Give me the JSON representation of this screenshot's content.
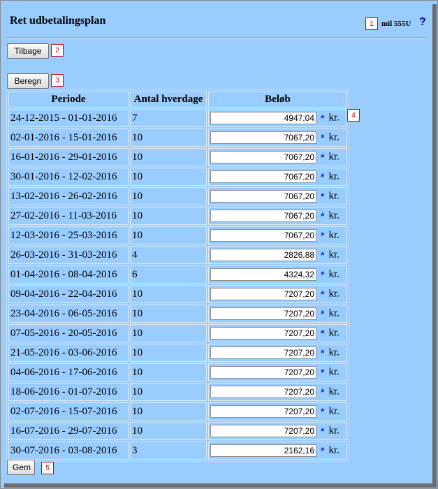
{
  "header": {
    "title": "Ret udbetalingsplan",
    "user": "mil 555U",
    "help": "?"
  },
  "badges": [
    "1",
    "2",
    "3",
    "4",
    "5"
  ],
  "buttons": {
    "back": "Tilbage",
    "calculate": "Beregn",
    "save": "Gem"
  },
  "table": {
    "columns": [
      "Periode",
      "Antal hverdage",
      "Beløb"
    ],
    "required_mark": "*",
    "unit": "kr.",
    "rows": [
      {
        "period": "24-12-2015 - 01-01-2016",
        "days": "7",
        "amount": "4947,04"
      },
      {
        "period": "02-01-2016 - 15-01-2016",
        "days": "10",
        "amount": "7067,20"
      },
      {
        "period": "16-01-2016 - 29-01-2016",
        "days": "10",
        "amount": "7067,20"
      },
      {
        "period": "30-01-2016 - 12-02-2016",
        "days": "10",
        "amount": "7067,20"
      },
      {
        "period": "13-02-2016 - 26-02-2016",
        "days": "10",
        "amount": "7067,20"
      },
      {
        "period": "27-02-2016 - 11-03-2016",
        "days": "10",
        "amount": "7067,20"
      },
      {
        "period": "12-03-2016 - 25-03-2016",
        "days": "10",
        "amount": "7067,20"
      },
      {
        "period": "26-03-2016 - 31-03-2016",
        "days": "4",
        "amount": "2826,88"
      },
      {
        "period": "01-04-2016 - 08-04-2016",
        "days": "6",
        "amount": "4324,32"
      },
      {
        "period": "09-04-2016 - 22-04-2016",
        "days": "10",
        "amount": "7207,20"
      },
      {
        "period": "23-04-2016 - 06-05-2016",
        "days": "10",
        "amount": "7207,20"
      },
      {
        "period": "07-05-2016 - 20-05-2016",
        "days": "10",
        "amount": "7207,20"
      },
      {
        "period": "21-05-2016 - 03-06-2016",
        "days": "10",
        "amount": "7207,20"
      },
      {
        "period": "04-06-2016 - 17-06-2016",
        "days": "10",
        "amount": "7207,20"
      },
      {
        "period": "18-06-2016 - 01-07-2016",
        "days": "10",
        "amount": "7207,20"
      },
      {
        "period": "02-07-2016 - 15-07-2016",
        "days": "10",
        "amount": "7207,20"
      },
      {
        "period": "16-07-2016 - 29-07-2016",
        "days": "10",
        "amount": "7207,20"
      },
      {
        "period": "30-07-2016 - 03-08-2016",
        "days": "3",
        "amount": "2162,16"
      }
    ]
  },
  "colors": {
    "background": "#99ccff",
    "badge_border": "#cc0000",
    "required_mark": "#1a33cc",
    "help": "#0000aa"
  }
}
